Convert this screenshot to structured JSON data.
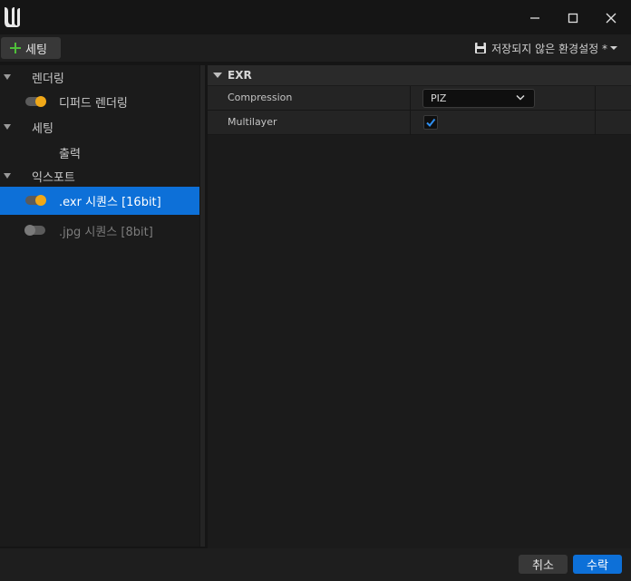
{
  "toolbar": {
    "settings_label": "세팅",
    "unsaved_label": "저장되지 않은 환경설정 *"
  },
  "tree": {
    "items": [
      {
        "label": "렌더링",
        "type": "category"
      },
      {
        "label": "디퍼드 렌더링",
        "type": "toggle",
        "enabled": true
      },
      {
        "label": "세팅",
        "type": "category"
      },
      {
        "label": "출력",
        "type": "item"
      },
      {
        "label": "익스포트",
        "type": "category"
      },
      {
        "label": ".exr 시퀀스 [16bit]",
        "type": "toggle",
        "enabled": true,
        "selected": true
      },
      {
        "label": ".jpg 시퀀스 [8bit]",
        "type": "toggle",
        "enabled": false
      }
    ]
  },
  "details": {
    "section_title": "EXR",
    "properties": [
      {
        "name": "Compression",
        "value": "PIZ"
      },
      {
        "name": "Multilayer",
        "checked": true
      }
    ]
  },
  "footer": {
    "cancel_label": "취소",
    "accept_label": "수락"
  },
  "colors": {
    "accent": "#0d70d8",
    "toggle_on": "#f0a818"
  }
}
